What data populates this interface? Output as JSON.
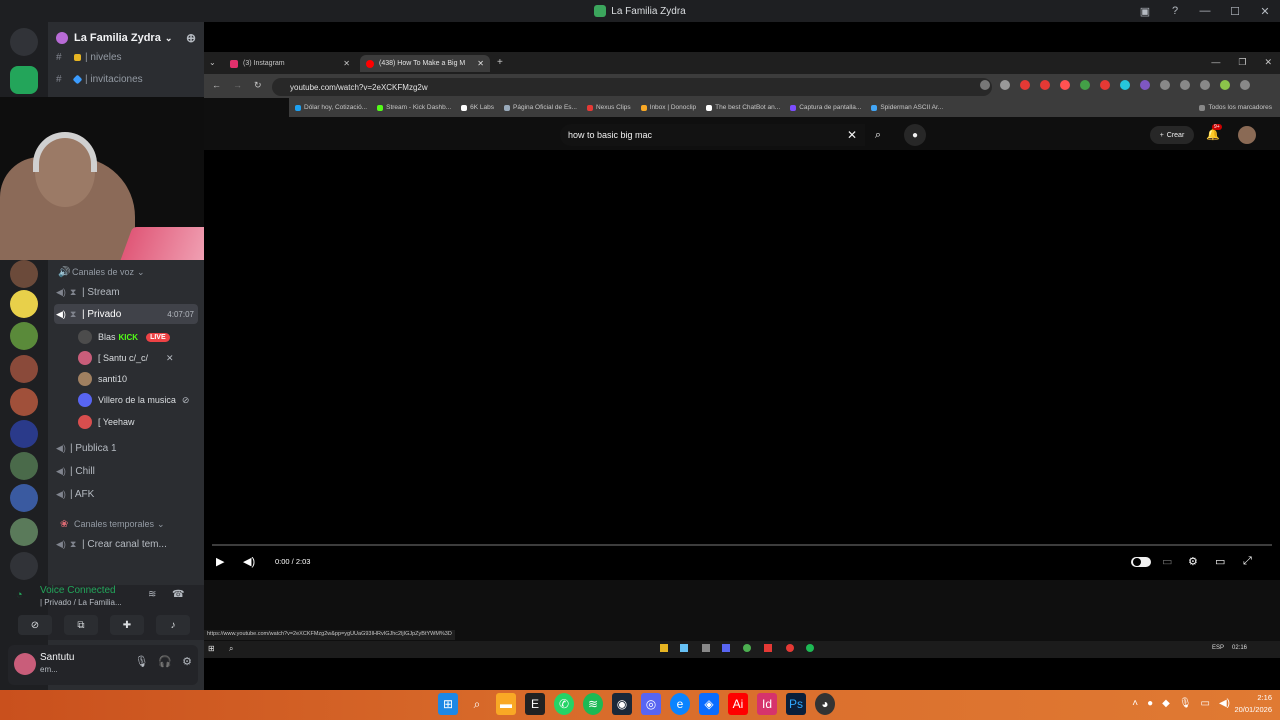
{
  "discord": {
    "window_title": "La Familia Zydra",
    "server_name": "La Familia Zydra",
    "text_channels": [
      {
        "label": "| niveles",
        "color": "#e6b422"
      },
      {
        "label": "| invitaciones",
        "color": "#3b9cff"
      }
    ],
    "voice_category": "Canales de voz",
    "voice_channels": [
      {
        "label": "| Stream"
      },
      {
        "label": "| Privado",
        "timer": "4:07:07"
      },
      {
        "label": "| Publica 1"
      },
      {
        "label": "| Chill"
      },
      {
        "label": "| AFK"
      }
    ],
    "voice_users": [
      {
        "name": "Blas",
        "tag": "KICK",
        "badge": "LIVE",
        "color": "#4c4c4c"
      },
      {
        "name": "[ Santu c/_c/",
        "color": "#c95d7a"
      },
      {
        "name": "santi10",
        "color": "#a08060"
      },
      {
        "name": "Villero de la musica",
        "color": "#5865f2"
      },
      {
        "name": "[ Yeehaw",
        "color": "#d84e4e"
      }
    ],
    "temp_category": "Canales temporales",
    "temp_channel": "| Crear canal tem...",
    "voice_status": "Voice Connected",
    "voice_sub": "| Privado / La Familia...",
    "user": {
      "name": "Santutu",
      "status": "em..."
    }
  },
  "browser": {
    "tabs": [
      {
        "label": "(3) Instagram",
        "color": "#e1306c",
        "active": false
      },
      {
        "label": "(438) How To Make a Big M",
        "color": "#ff0000",
        "active": true
      }
    ],
    "url": "youtube.com/watch?v=2eXCKFMzg2w",
    "bookmarks": [
      {
        "label": "Dólar hoy, Cotizació...",
        "color": "#1da1f2"
      },
      {
        "label": "Stream - Kick Dashb...",
        "color": "#53fc18"
      },
      {
        "label": "6K Labs",
        "color": "#ffffff"
      },
      {
        "label": "Página Oficial de Es...",
        "color": "#9ab"
      },
      {
        "label": "Nexus Clips",
        "color": "#e53935"
      },
      {
        "label": "Inbox | Donoclip",
        "color": "#f9a825"
      },
      {
        "label": "The best ChatBot an...",
        "color": "#ffffff"
      },
      {
        "label": "Captura de pantalla...",
        "color": "#7c4dff"
      },
      {
        "label": "Spiderman ASCII Ar...",
        "color": "#42a5f5"
      }
    ],
    "all_bookmarks": "Todos los marcadores",
    "status_url": "https://www.youtube.com/watch?v=2eXCKFMzg2w&pp=ygUUaG93IHRvIGJhc2ljIGJpZyBtYWM%3D"
  },
  "youtube": {
    "search_query": "how to basic big mac",
    "create_label": "Crear",
    "notif_count": "9+",
    "time_display": "0:00 / 2:03",
    "progress": 0
  },
  "taskbar": {
    "time": "2:16",
    "date": "20/01/2026"
  },
  "inner_taskbar": {
    "lang": "ESP",
    "time": "02:16"
  }
}
